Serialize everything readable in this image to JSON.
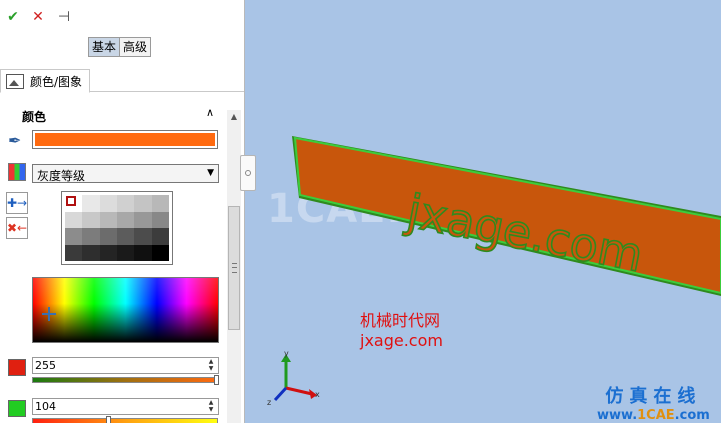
{
  "toolbar": {
    "ok_glyph": "✔",
    "cancel_glyph": "✕",
    "pin_glyph": "⊣"
  },
  "mode_tabs": {
    "basic": "基本",
    "advanced": "高级"
  },
  "property_tab": {
    "label": "颜色/图象"
  },
  "color_section": {
    "title": "颜色",
    "current_color": "#ff6a10",
    "palette_select": "灰度等级",
    "grayscale_swatches": [
      "#ffffff",
      "#e8e8e8",
      "#dcdcdc",
      "#d0d0d0",
      "#c4c4c4",
      "#b8b8b8",
      "#d8d8d8",
      "#c8c8c8",
      "#b8b8b8",
      "#a8a8a8",
      "#989898",
      "#888888",
      "#8c8c8c",
      "#7c7c7c",
      "#6c6c6c",
      "#5c5c5c",
      "#4c4c4c",
      "#3c3c3c",
      "#3a3a3a",
      "#2e2e2e",
      "#242424",
      "#1a1a1a",
      "#101010",
      "#000000"
    ],
    "red": {
      "value": "255",
      "fraction": 1.0,
      "swatch": "#e02010"
    },
    "green": {
      "value": "104",
      "fraction": 0.41,
      "swatch": "#22cc22"
    }
  },
  "viewport": {
    "model_text": "jxage.com",
    "watermark": "1CAE.COM",
    "label_cn": "机械时代网",
    "label_url": "jxage.com",
    "footer_cn": "仿真在线",
    "footer_url_prefix": "www.",
    "footer_url_brand": "1CAE",
    "footer_url_suffix": ".com",
    "bar_color": "#c8560c",
    "edge_color": "#3ccc3c"
  },
  "triad": {
    "x": "x",
    "y": "y",
    "z": "z"
  }
}
